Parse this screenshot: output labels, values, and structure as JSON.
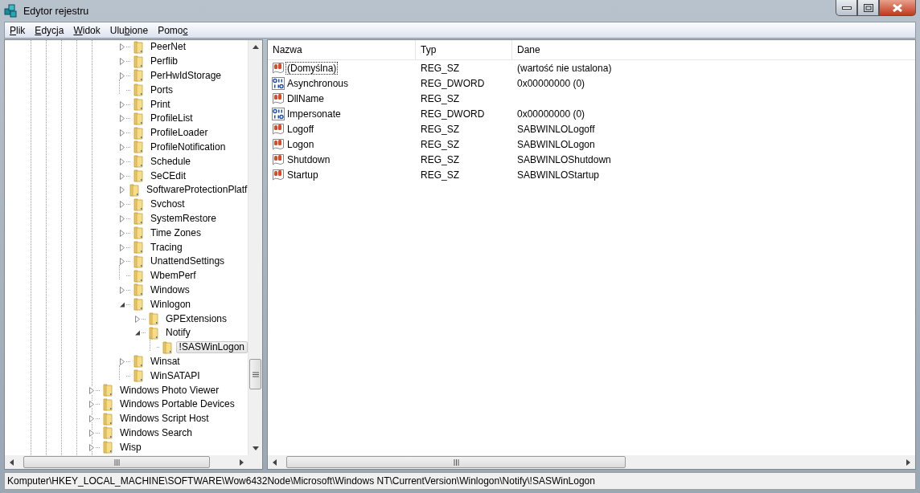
{
  "window": {
    "title": "Edytor rejestru"
  },
  "menu": [
    {
      "key": "P",
      "after": "lik"
    },
    {
      "key": "E",
      "after": "dycja"
    },
    {
      "key": "W",
      "after": "idok"
    },
    {
      "before": "Ulu",
      "key": "b",
      "after": "ione"
    },
    {
      "before": "Pomo",
      "key": "c"
    }
  ],
  "tree": [
    {
      "children": [
        {
          "children": [
            {
              "label": "PeerNet",
              "kind": "collapsed",
              "selected": false
            },
            {
              "label": "Perflib",
              "kind": "collapsed",
              "selected": false
            },
            {
              "label": "PerHwIdStorage",
              "kind": "collapsed",
              "selected": false
            },
            {
              "label": "Ports",
              "kind": "leaf",
              "selected": false
            },
            {
              "label": "Print",
              "kind": "collapsed",
              "selected": false
            },
            {
              "label": "ProfileList",
              "kind": "collapsed",
              "selected": false
            },
            {
              "label": "ProfileLoader",
              "kind": "collapsed",
              "selected": false
            },
            {
              "label": "ProfileNotification",
              "kind": "collapsed",
              "selected": false
            },
            {
              "label": "Schedule",
              "kind": "collapsed",
              "selected": false
            },
            {
              "label": "SeCEdit",
              "kind": "collapsed",
              "selected": false
            },
            {
              "label": "SoftwareProtectionPlatf",
              "kind": "collapsed",
              "selected": false
            },
            {
              "label": "Svchost",
              "kind": "collapsed",
              "selected": false
            },
            {
              "label": "SystemRestore",
              "kind": "collapsed",
              "selected": false
            },
            {
              "label": "Time Zones",
              "kind": "collapsed",
              "selected": false
            },
            {
              "label": "Tracing",
              "kind": "collapsed",
              "selected": false
            },
            {
              "label": "UnattendSettings",
              "kind": "collapsed",
              "selected": false
            },
            {
              "label": "WbemPerf",
              "kind": "leaf",
              "selected": false
            },
            {
              "label": "Windows",
              "kind": "collapsed",
              "selected": false
            },
            {
              "label": "Winlogon",
              "kind": "expanded",
              "selected": false,
              "children": [
                {
                  "label": "GPExtensions",
                  "kind": "collapsed",
                  "selected": false
                },
                {
                  "label": "Notify",
                  "kind": "expanded",
                  "selected": false,
                  "children": [
                    {
                      "label": "!SASWinLogon",
                      "kind": "leaf",
                      "selected": true
                    }
                  ]
                }
              ]
            },
            {
              "label": "Winsat",
              "kind": "collapsed",
              "selected": false
            },
            {
              "label": "WinSATAPI",
              "kind": "leaf",
              "selected": false
            }
          ]
        }
      ]
    },
    {
      "label": "Windows Photo Viewer",
      "kind": "collapsed",
      "selected": false
    },
    {
      "label": "Windows Portable Devices",
      "kind": "collapsed",
      "selected": false
    },
    {
      "label": "Windows Script Host",
      "kind": "collapsed",
      "selected": false
    },
    {
      "label": "Windows Search",
      "kind": "collapsed",
      "selected": false
    },
    {
      "label": "Wisp",
      "kind": "collapsed",
      "selected": false
    }
  ],
  "values": {
    "columns": [
      "Nazwa",
      "Typ",
      "Dane"
    ],
    "rows": [
      {
        "kind": "string",
        "name": "(Domyślna)",
        "type": "REG_SZ",
        "data": "(wartość nie ustalona)",
        "focused": true
      },
      {
        "kind": "binary",
        "name": "Asynchronous",
        "type": "REG_DWORD",
        "data": "0x00000000 (0)",
        "focused": false
      },
      {
        "kind": "string",
        "name": "DllName",
        "type": "REG_SZ",
        "focused": false
      },
      {
        "kind": "binary",
        "name": "Impersonate",
        "type": "REG_DWORD",
        "data": "0x00000000 (0)",
        "focused": false
      },
      {
        "kind": "string",
        "name": "Logoff",
        "type": "REG_SZ",
        "data": "SABWINLOLogoff",
        "focused": false
      },
      {
        "kind": "string",
        "name": "Logon",
        "type": "REG_SZ",
        "data": "SABWINLOLogon",
        "focused": false
      },
      {
        "kind": "string",
        "name": "Shutdown",
        "type": "REG_SZ",
        "data": "SABWINLOShutdown",
        "focused": false
      },
      {
        "kind": "string",
        "name": "Startup",
        "type": "REG_SZ",
        "data": "SABWINLOStartup",
        "focused": false
      }
    ]
  },
  "status_bar": "Komputer\\HKEY_LOCAL_MACHINE\\SOFTWARE\\Wow6432Node\\Microsoft\\Windows NT\\CurrentVersion\\Winlogon\\Notify\\!SASWinLogon"
}
